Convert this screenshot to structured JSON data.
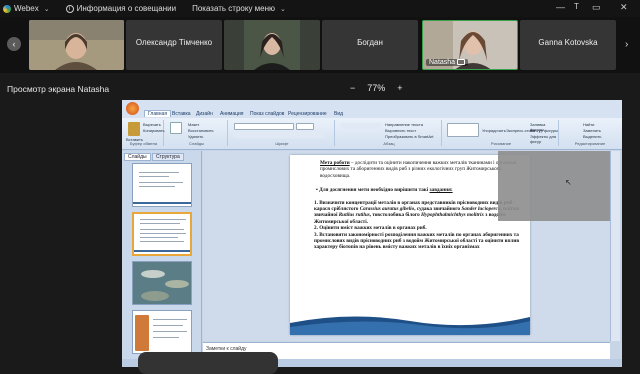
{
  "topbar": {
    "app": "Webex",
    "info": "Информация о совещании",
    "menu": "Показать строку меню",
    "user_initial": "T"
  },
  "participants": [
    {
      "name": "",
      "video": true
    },
    {
      "name": "Олександр Тімченко",
      "video": false
    },
    {
      "name": "",
      "video": true
    },
    {
      "name": "Богдан",
      "video": false
    },
    {
      "name": "Natasha",
      "video": true
    },
    {
      "name": "Ganna Kotovska",
      "video": false
    }
  ],
  "share": {
    "title": "Просмотр экрана Natasha",
    "zoom_out": "−",
    "zoom_level": "77%",
    "zoom_in": "+"
  },
  "ppt": {
    "tabs": [
      "Главная",
      "Вставка",
      "Дизайн",
      "Анимация",
      "Показ слайдов",
      "Рецензирование",
      "Вид"
    ],
    "ribbon": {
      "clipboard": "Буфер обмена",
      "paste": "Вставить",
      "cut": "Вырезать",
      "copy": "Копировать",
      "format": "Формат по образцу",
      "slides": "Слайды",
      "new_slide": "Создать слайд",
      "layout": "Макет",
      "reset": "Восстановить",
      "delete": "Удалить",
      "font": "Шрифт",
      "paragraph": "Абзац",
      "drawing": "Рисование",
      "arrange": "Упорядочить",
      "styles": "Экспресс-стили",
      "editing": "Редактирование",
      "find": "Найти",
      "replace": "Заменить",
      "select": "Выделить",
      "text_direction": "Направление текста",
      "align_text": "Выровнять текст",
      "smartart": "Преобразовать в SmartArt",
      "fill": "Заливка фигуры",
      "outline": "Контур фигуры",
      "effects": "Эффекты для фигур"
    },
    "pane_tabs": [
      "Слайды",
      "Структура"
    ],
    "thumb_numbers": [
      "1",
      "2",
      "3",
      "4"
    ],
    "notes_placeholder": "Заметки к слайду",
    "slide": {
      "goal_label": "Мета роботи",
      "goal_text": " – дослідити та оцінити накопичення важких металів тканинами і органами промислових та аборигенних видів риб з різних екологічних груп Житомирського водосховища.",
      "task_intro": "Для досягнення мети необхідно вирішити такі ",
      "task_word": "завдання:",
      "items": [
        {
          "n": "1.",
          "pre": "Визначити концентрації металів в органах представників пріснoводних видів риб - карася сріблястого ",
          "latin1": "Carassius auratus gibelio",
          "mid": ", судака звичайного ",
          "latin2": "Sander lucioperca",
          "mid2": ", плітки звичайної ",
          "latin3": "Rutilus rutilus",
          "mid3": ", товстолобика білого ",
          "latin4": "Hypophthalmichthys molitrix",
          "post": " з водойм Житомирської області."
        },
        {
          "n": "2.",
          "text": "Оцінити вміст важких металів в органах риб."
        },
        {
          "n": "3.",
          "text": "Встановити закономірності розподілення важких металів по органах аборигенних та промислових видів прісноводних риб з водойм Житомирської області та оцінити вплив характеру біотопів на рівень вмісту важких металів в їхніх організмах"
        }
      ]
    }
  },
  "colors": {
    "background": "#1a1a1a",
    "ribbon": "#d6e2f1",
    "accent": "#1f3d6b"
  }
}
